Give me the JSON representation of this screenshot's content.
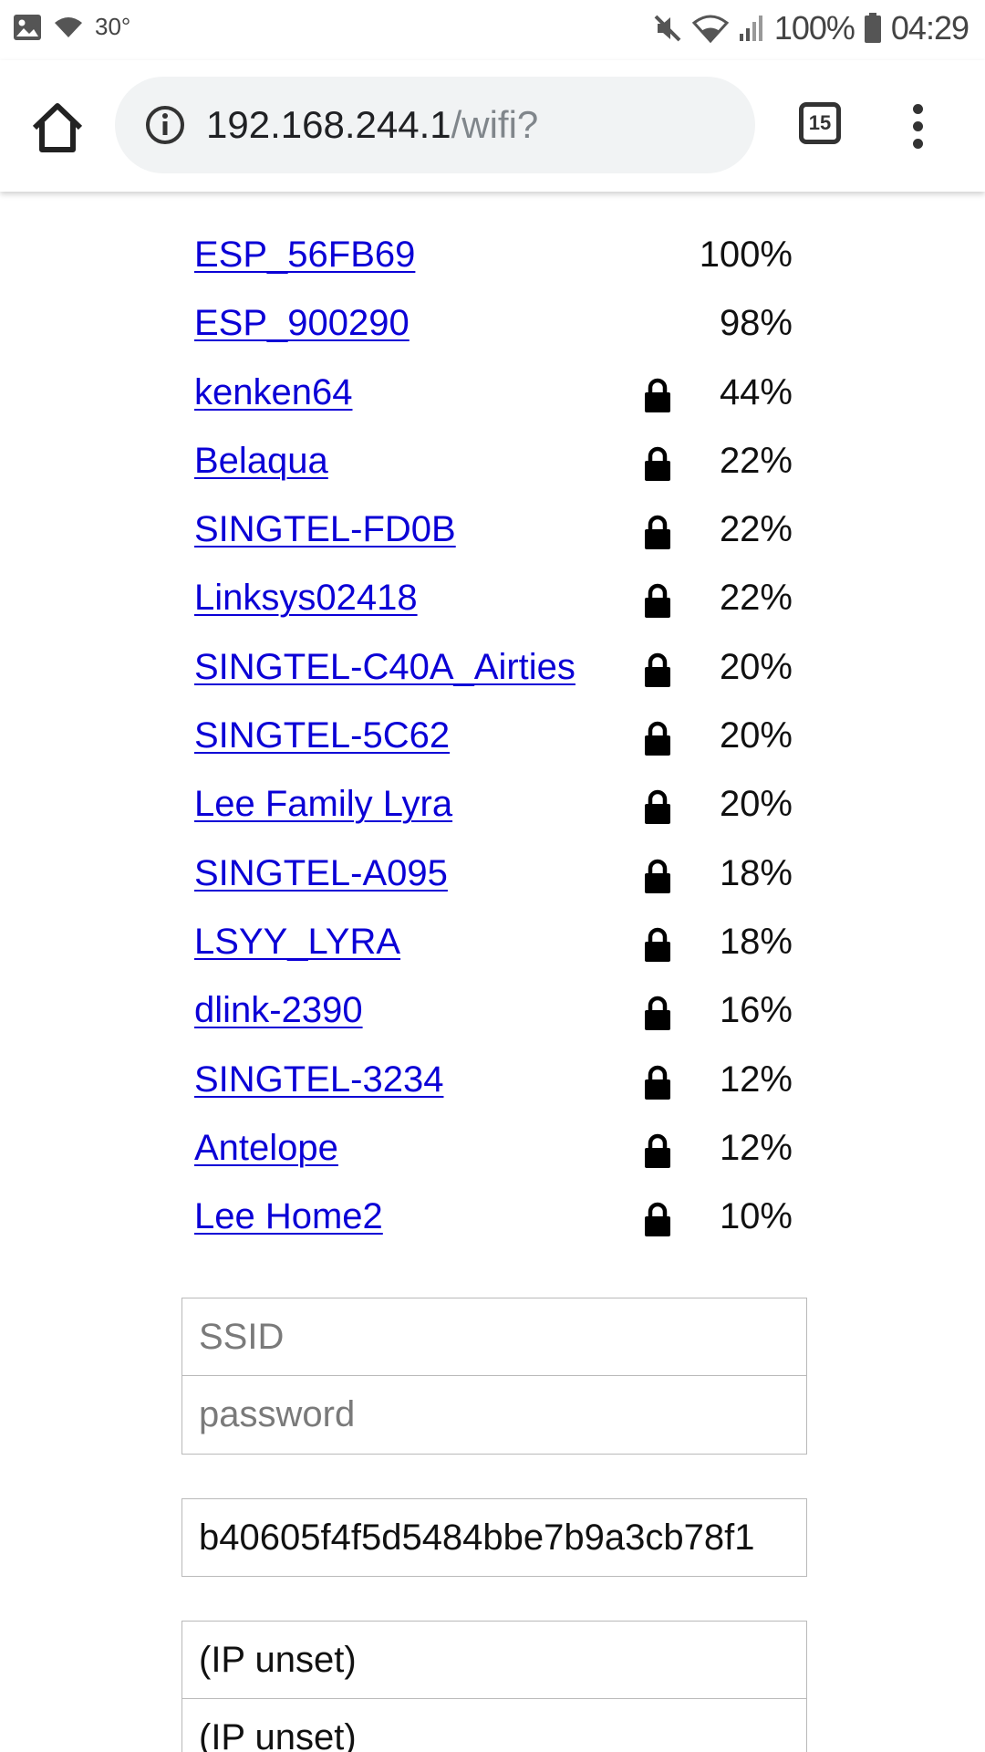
{
  "status_bar": {
    "temperature": "30°",
    "battery_percent": "100%",
    "time": "04:29",
    "icons": [
      "image-icon",
      "wifi-icon",
      "mute-icon",
      "wifi-icon",
      "signal-icon",
      "battery-icon"
    ]
  },
  "toolbar": {
    "url_host": "192.168.244.1",
    "url_path": "/wifi?",
    "tab_count": "15",
    "icons": [
      "home-icon",
      "info-icon",
      "tabs-icon",
      "more-vert-icon"
    ]
  },
  "networks": [
    {
      "ssid": "ESP_56FB69",
      "locked": false,
      "quality": "100%"
    },
    {
      "ssid": "ESP_900290",
      "locked": false,
      "quality": "98%"
    },
    {
      "ssid": "kenken64",
      "locked": true,
      "quality": "44%"
    },
    {
      "ssid": "Belaqua",
      "locked": true,
      "quality": "22%"
    },
    {
      "ssid": "SINGTEL-FD0B",
      "locked": true,
      "quality": "22%"
    },
    {
      "ssid": "Linksys02418",
      "locked": true,
      "quality": "22%"
    },
    {
      "ssid": "SINGTEL-C40A_Airties",
      "locked": true,
      "quality": "20%"
    },
    {
      "ssid": "SINGTEL-5C62",
      "locked": true,
      "quality": "20%"
    },
    {
      "ssid": "Lee Family Lyra",
      "locked": true,
      "quality": "20%"
    },
    {
      "ssid": "SINGTEL-A095",
      "locked": true,
      "quality": "18%"
    },
    {
      "ssid": "LSYY_LYRA",
      "locked": true,
      "quality": "18%"
    },
    {
      "ssid": "dlink-2390",
      "locked": true,
      "quality": "16%"
    },
    {
      "ssid": "SINGTEL-3234",
      "locked": true,
      "quality": "12%"
    },
    {
      "ssid": "Antelope",
      "locked": true,
      "quality": "12%"
    },
    {
      "ssid": "Lee Home2",
      "locked": true,
      "quality": "10%"
    }
  ],
  "form": {
    "ssid_placeholder": "SSID",
    "password_placeholder": "password",
    "token_value": "b40605f4f5d5484bbe7b9a3cb78f1",
    "ip_field_1": "(IP unset)",
    "ip_field_2": "(IP unset)"
  },
  "colors": {
    "link": "#0b00d6",
    "omnibox_bg": "#f1f3f4",
    "url_path": "#80868b"
  }
}
